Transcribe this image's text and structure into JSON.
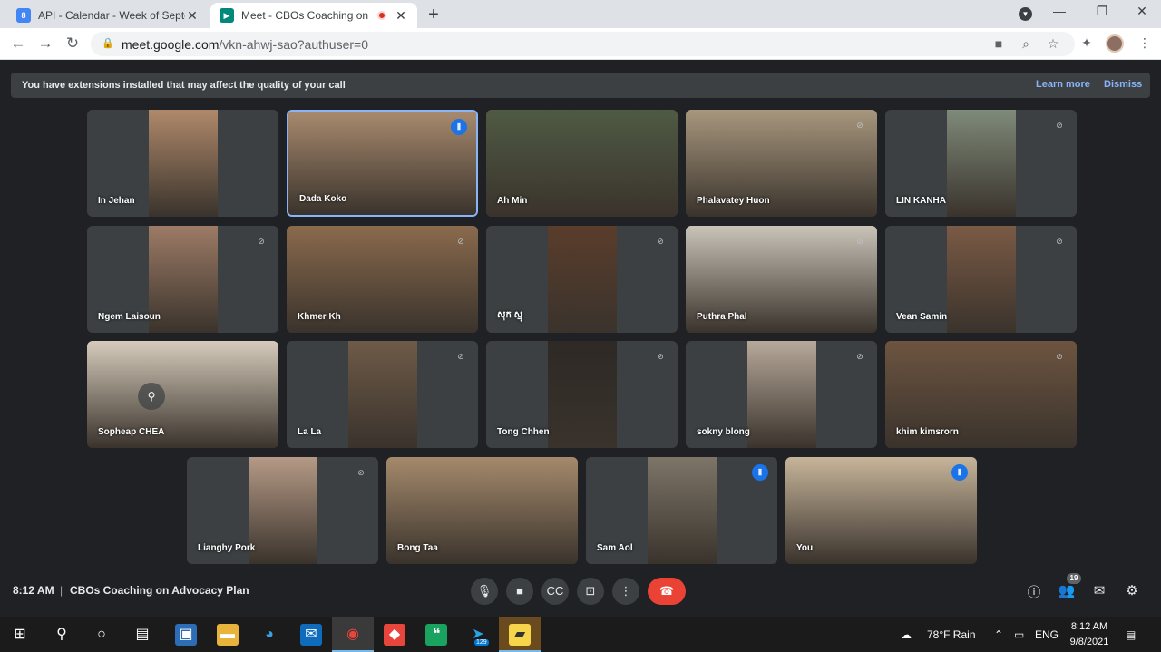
{
  "browser": {
    "tabs": [
      {
        "title": "API - Calendar - Week of Septem",
        "favicon": "calendar-icon",
        "favicon_text": "8",
        "favicon_color": "#4285f4"
      },
      {
        "title": "Meet - CBOs Coaching on Ad",
        "favicon": "meet-icon",
        "favicon_color": "#00897b"
      }
    ],
    "url_host": "meet.google.com",
    "url_path": "/vkn-ahwj-sao?authuser=0"
  },
  "meet": {
    "banner": {
      "message": "You have extensions installed that may affect the quality of your call",
      "learn_more": "Learn more",
      "dismiss": "Dismiss"
    },
    "participants": [
      {
        "name": "In Jehan",
        "mic": "none",
        "color": "#b0896b"
      },
      {
        "name": "Dada Koko",
        "mic": "active",
        "color": "#a88a6e"
      },
      {
        "name": "Ah Min",
        "mic": "none",
        "color": "#4f5a43"
      },
      {
        "name": "Phalavatey Huon",
        "mic": "muted",
        "color": "#a8977e"
      },
      {
        "name": "LIN KANHA",
        "mic": "muted",
        "color": "#7f8a7a"
      },
      {
        "name": "Ngem Laisoun",
        "mic": "muted",
        "color": "#9d7b66"
      },
      {
        "name": "Khmer Kh",
        "mic": "muted",
        "color": "#8a6a4d"
      },
      {
        "name": "សុក ស្មុ",
        "mic": "muted",
        "color": "#5a3d2b"
      },
      {
        "name": "Puthra Phal",
        "mic": "muted",
        "color": "#c9c3b8"
      },
      {
        "name": "Vean Samin",
        "mic": "muted",
        "color": "#7a5a45"
      },
      {
        "name": "Sopheap CHEA",
        "mic": "none",
        "color": "#d6cbbb"
      },
      {
        "name": "La La",
        "mic": "muted",
        "color": "#6e5a48"
      },
      {
        "name": "Tong Chhen",
        "mic": "muted",
        "color": "#2e2926"
      },
      {
        "name": "sokny blong",
        "mic": "muted",
        "color": "#b7a99a"
      },
      {
        "name": "khim kimsrorn",
        "mic": "muted",
        "color": "#6d5440"
      },
      {
        "name": "Lianghy Pork",
        "mic": "muted",
        "color": "#b59a86"
      },
      {
        "name": "Bong Taa",
        "mic": "none",
        "color": "#a58a6c"
      },
      {
        "name": "Sam Aol",
        "mic": "active",
        "color": "#7d7568"
      },
      {
        "name": "You",
        "mic": "active",
        "color": "#c7b59a"
      }
    ],
    "clock": "8:12 AM",
    "separator": "|",
    "meeting_name": "CBOs Coaching on Advocacy Plan",
    "participant_count": "19"
  },
  "taskbar": {
    "weather": "78°F  Rain",
    "language": "ENG",
    "time": "8:12 AM",
    "date": "9/8/2021",
    "telegram_badge": "129"
  }
}
